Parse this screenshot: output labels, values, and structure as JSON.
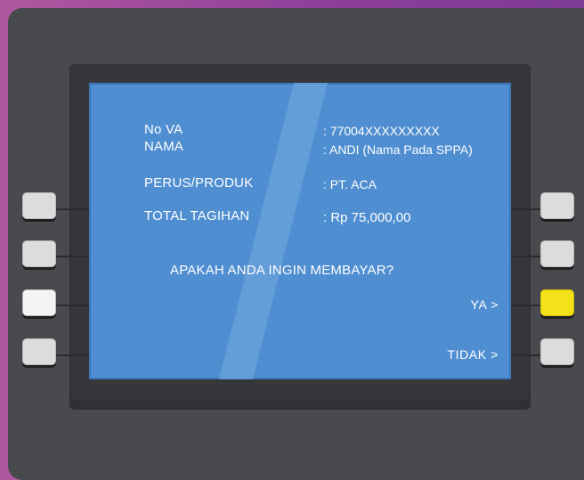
{
  "screen": {
    "fields": [
      {
        "label": "No VA",
        "value": ": 77004XXXXXXXXX"
      },
      {
        "label": "NAMA",
        "value": ": ANDI (Nama Pada SPPA)"
      },
      {
        "label": "PERUS/PRODUK",
        "value": ": PT. ACA"
      },
      {
        "label": "TOTAL TAGIHAN",
        "value": ": Rp 75,000,00"
      }
    ],
    "question": "APAKAH ANDA INGIN MEMBAYAR?",
    "options": {
      "yes_label": "YA >",
      "no_label": "TIDAK >"
    }
  },
  "colors": {
    "screen": "#4f8ed0",
    "casing": "#484a4e",
    "background": "#9a4a9c",
    "highlight_button": "#f3e21a"
  }
}
